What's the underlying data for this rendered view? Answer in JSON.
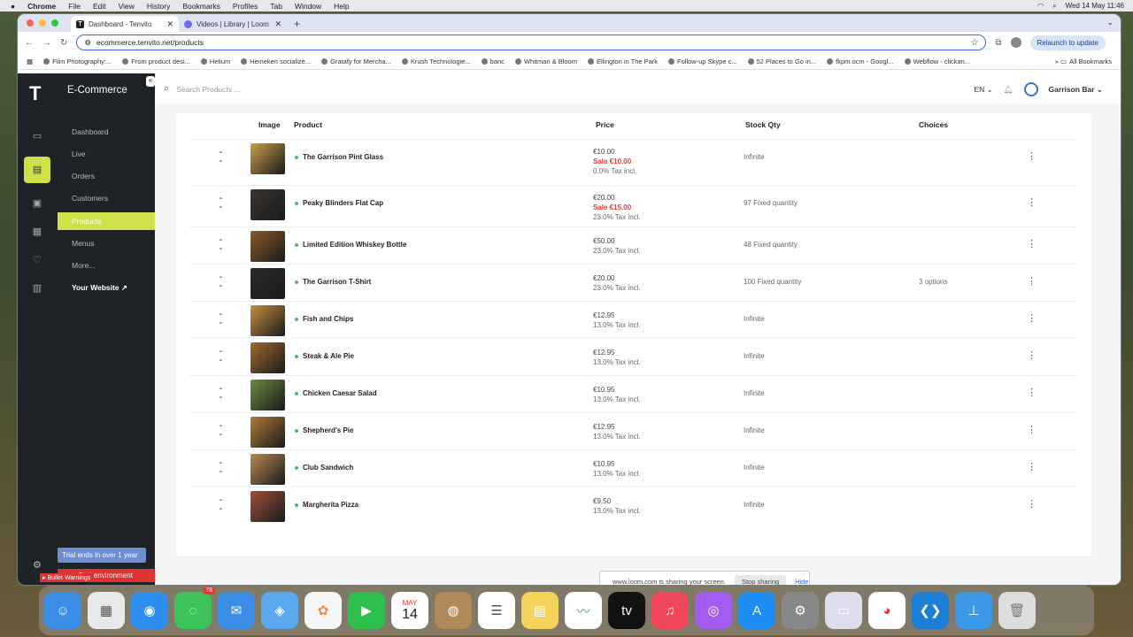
{
  "menubar": {
    "items": [
      "Chrome",
      "File",
      "Edit",
      "View",
      "History",
      "Bookmarks",
      "Profiles",
      "Tab",
      "Window",
      "Help"
    ],
    "datetime": "Wed 14 May 11:46"
  },
  "tabs": [
    {
      "title": "Dashboard - Tenvito"
    },
    {
      "title": "Videos | Library | Loom"
    }
  ],
  "toolbar": {
    "url": "ecommerce.tenvito.net/products",
    "relaunch": "Relaunch to update"
  },
  "bookmarks": [
    "Film Photography:...",
    "From product desi...",
    "Helium",
    "Heineken socialize...",
    "Gratafy for Mercha...",
    "Krush Technologie...",
    "banc",
    "Whitman & Bloom",
    "Ellington in The Park",
    "Follow-up Skype c...",
    "52 Places to Go in...",
    "fkpm.ocm - Googl...",
    "Webflow - clickan..."
  ],
  "bookmarks_all": "All Bookmarks",
  "app": {
    "logo": "T",
    "brand": "E-Commerce",
    "nav": [
      {
        "label": "Dashboard"
      },
      {
        "label": "Live"
      },
      {
        "label": "Orders"
      },
      {
        "label": "Customers"
      },
      {
        "label": "Products",
        "active": true
      },
      {
        "label": "Menus"
      },
      {
        "label": "More..."
      },
      {
        "label": "Your Website"
      }
    ],
    "trial": "Trial ends in over 1 year",
    "test_env": "Test environment",
    "bullet": "Bullet Warnings"
  },
  "topbar": {
    "search_placeholder": "Search Products ...",
    "lang": "EN",
    "user": "Garrison Bar"
  },
  "table": {
    "headers": {
      "image": "Image",
      "product": "Product",
      "price": "Price",
      "stock": "Stock Qty",
      "choices": "Choices"
    },
    "rows": [
      {
        "name": "The Garrison Pint Glass",
        "price": "€10.00",
        "sale": "Sale €10.00",
        "tax": "0.0% Tax incl.",
        "stock": "Infinite",
        "choices": "",
        "color": "#c8a04a"
      },
      {
        "name": "Peaky Blinders Flat Cap",
        "price": "€20.00",
        "sale": "Sale €15.00",
        "tax": "23.0% Tax incl.",
        "stock": "97 Fixed quantity",
        "choices": "",
        "color": "#3a3530"
      },
      {
        "name": "Limited Edition Whiskey Bottle",
        "price": "€50.00",
        "sale": "",
        "tax": "23.0% Tax incl.",
        "stock": "48 Fixed quantity",
        "choices": "",
        "color": "#8a5a2a"
      },
      {
        "name": "The Garrison T-Shirt",
        "price": "€20.00",
        "sale": "",
        "tax": "23.0% Tax incl.",
        "stock": "100 Fixed quantity",
        "choices": "3 options",
        "color": "#2a2a2a"
      },
      {
        "name": "Fish and Chips",
        "price": "€12.95",
        "sale": "",
        "tax": "13.0% Tax incl.",
        "stock": "Infinite",
        "choices": "",
        "color": "#c89040"
      },
      {
        "name": "Steak & Ale Pie",
        "price": "€12.95",
        "sale": "",
        "tax": "13.0% Tax incl.",
        "stock": "Infinite",
        "choices": "",
        "color": "#a06a30"
      },
      {
        "name": "Chicken Caesar Salad",
        "price": "€10.95",
        "sale": "",
        "tax": "13.0% Tax incl.",
        "stock": "Infinite",
        "choices": "",
        "color": "#6a8a40"
      },
      {
        "name": "Shepherd's Pie",
        "price": "€12.95",
        "sale": "",
        "tax": "13.0% Tax incl.",
        "stock": "Infinite",
        "choices": "",
        "color": "#b07a38"
      },
      {
        "name": "Club Sandwich",
        "price": "€10.95",
        "sale": "",
        "tax": "13.0% Tax incl.",
        "stock": "Infinite",
        "choices": "",
        "color": "#b88a50"
      },
      {
        "name": "Margherita Pizza",
        "price": "€9.50",
        "sale": "",
        "tax": "13.0% Tax incl.",
        "stock": "Infinite",
        "choices": "",
        "color": "#a0503a"
      }
    ]
  },
  "loom": {
    "msg": "www.loom.com is sharing your screen.",
    "stop": "Stop sharing",
    "hide": "Hide"
  },
  "dock": {
    "messages_badge": "78",
    "calendar_month": "MAY",
    "calendar_day": "14"
  }
}
